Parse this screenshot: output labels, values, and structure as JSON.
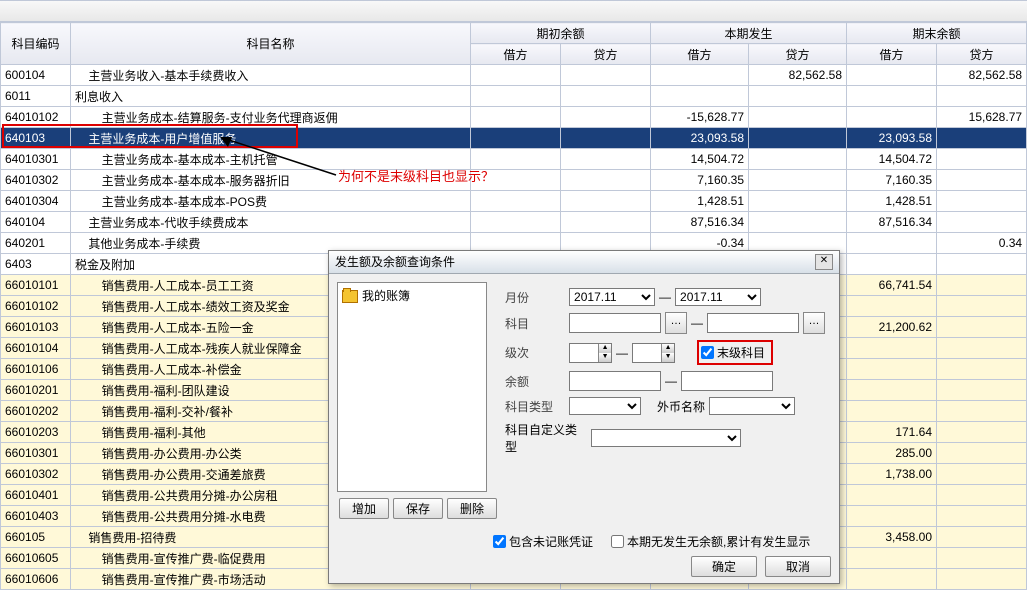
{
  "headers": {
    "code": "科目编码",
    "name": "科目名称",
    "opening": "期初余额",
    "current": "本期发生",
    "ending": "期末余额",
    "debit": "借方",
    "credit": "贷方"
  },
  "rows": [
    {
      "code": "600104",
      "name": "主营业务收入-基本手续费收入",
      "ind": 1,
      "oD": "",
      "oC": "",
      "cD": "",
      "cC": "82,562.58",
      "eD": "",
      "eC": "82,562.58"
    },
    {
      "code": "6011",
      "name": "利息收入",
      "ind": 0,
      "oD": "",
      "oC": "",
      "cD": "",
      "cC": "",
      "eD": "",
      "eC": ""
    },
    {
      "code": "64010102",
      "name": "主营业务成本-结算服务-支付业务代理商返佣",
      "ind": 2,
      "oD": "",
      "oC": "",
      "cD": "-15,628.77",
      "cC": "",
      "eD": "",
      "eC": "15,628.77"
    },
    {
      "code": "640103",
      "name": "主营业务成本-用户增值服务",
      "ind": 1,
      "oD": "",
      "oC": "",
      "cD": "23,093.58",
      "cC": "",
      "eD": "23,093.58",
      "eC": "",
      "sel": true
    },
    {
      "code": "64010301",
      "name": "主营业务成本-基本成本-主机托管",
      "ind": 2,
      "oD": "",
      "oC": "",
      "cD": "14,504.72",
      "cC": "",
      "eD": "14,504.72",
      "eC": ""
    },
    {
      "code": "64010302",
      "name": "主营业务成本-基本成本-服务器折旧",
      "ind": 2,
      "oD": "",
      "oC": "",
      "cD": "7,160.35",
      "cC": "",
      "eD": "7,160.35",
      "eC": ""
    },
    {
      "code": "64010304",
      "name": "主营业务成本-基本成本-POS费",
      "ind": 2,
      "oD": "",
      "oC": "",
      "cD": "1,428.51",
      "cC": "",
      "eD": "1,428.51",
      "eC": ""
    },
    {
      "code": "640104",
      "name": "主营业务成本-代收手续费成本",
      "ind": 1,
      "oD": "",
      "oC": "",
      "cD": "87,516.34",
      "cC": "",
      "eD": "87,516.34",
      "eC": ""
    },
    {
      "code": "640201",
      "name": "其他业务成本-手续费",
      "ind": 1,
      "oD": "",
      "oC": "",
      "cD": "-0.34",
      "cC": "",
      "eD": "",
      "eC": "0.34"
    },
    {
      "code": "6403",
      "name": "税金及附加",
      "ind": 0,
      "oD": "",
      "oC": "",
      "cD": "",
      "cC": "",
      "eD": "",
      "eC": ""
    },
    {
      "code": "66010101",
      "name": "销售费用-人工成本-员工工资",
      "ind": 2,
      "hl": true,
      "oD": "",
      "oC": "",
      "cD": "",
      "cC": "",
      "eD": "66,741.54",
      "eC": ""
    },
    {
      "code": "66010102",
      "name": "销售费用-人工成本-绩效工资及奖金",
      "ind": 2,
      "hl": true,
      "oD": "",
      "oC": "",
      "cD": "",
      "cC": "",
      "eD": "",
      "eC": ""
    },
    {
      "code": "66010103",
      "name": "销售费用-人工成本-五险一金",
      "ind": 2,
      "hl": true,
      "oD": "",
      "oC": "",
      "cD": "",
      "cC": "",
      "eD": "21,200.62",
      "eC": ""
    },
    {
      "code": "66010104",
      "name": "销售费用-人工成本-残疾人就业保障金",
      "ind": 2,
      "hl": true,
      "oD": "",
      "oC": "",
      "cD": "",
      "cC": "",
      "eD": "",
      "eC": ""
    },
    {
      "code": "66010106",
      "name": "销售费用-人工成本-补偿金",
      "ind": 2,
      "hl": true,
      "oD": "",
      "oC": "",
      "cD": "",
      "cC": "",
      "eD": "",
      "eC": ""
    },
    {
      "code": "66010201",
      "name": "销售费用-福利-团队建设",
      "ind": 2,
      "hl": true,
      "oD": "",
      "oC": "",
      "cD": "",
      "cC": "",
      "eD": "",
      "eC": ""
    },
    {
      "code": "66010202",
      "name": "销售费用-福利-交补/餐补",
      "ind": 2,
      "hl": true,
      "oD": "",
      "oC": "",
      "cD": "",
      "cC": "",
      "eD": "",
      "eC": ""
    },
    {
      "code": "66010203",
      "name": "销售费用-福利-其他",
      "ind": 2,
      "hl": true,
      "oD": "",
      "oC": "",
      "cD": "",
      "cC": "",
      "eD": "171.64",
      "eC": ""
    },
    {
      "code": "66010301",
      "name": "销售费用-办公费用-办公类",
      "ind": 2,
      "hl": true,
      "oD": "",
      "oC": "",
      "cD": "",
      "cC": "",
      "eD": "285.00",
      "eC": ""
    },
    {
      "code": "66010302",
      "name": "销售费用-办公费用-交通差旅费",
      "ind": 2,
      "hl": true,
      "oD": "",
      "oC": "",
      "cD": "",
      "cC": "",
      "eD": "1,738.00",
      "eC": ""
    },
    {
      "code": "66010401",
      "name": "销售费用-公共费用分摊-办公房租",
      "ind": 2,
      "hl": true,
      "oD": "",
      "oC": "",
      "cD": "",
      "cC": "",
      "eD": "",
      "eC": ""
    },
    {
      "code": "66010403",
      "name": "销售费用-公共费用分摊-水电费",
      "ind": 2,
      "hl": true,
      "oD": "",
      "oC": "",
      "cD": "",
      "cC": "",
      "eD": "",
      "eC": ""
    },
    {
      "code": "660105",
      "name": "销售费用-招待费",
      "ind": 1,
      "hl": true,
      "oD": "",
      "oC": "",
      "cD": "",
      "cC": "",
      "eD": "3,458.00",
      "eC": ""
    },
    {
      "code": "66010605",
      "name": "销售费用-宣传推广费-临促费用",
      "ind": 2,
      "hl": true,
      "oD": "",
      "oC": "",
      "cD": "",
      "cC": "",
      "eD": "",
      "eC": ""
    },
    {
      "code": "66010606",
      "name": "销售费用-宣传推广费-市场活动",
      "ind": 2,
      "hl": true,
      "oD": "",
      "oC": "",
      "cD": "",
      "cC": "",
      "eD": "",
      "eC": ""
    }
  ],
  "annotation_text": "为何不是末级科目也显示？",
  "dialog": {
    "title": "发生额及余额查询条件",
    "tree_root": "我的账簿",
    "btn_add": "增加",
    "btn_save": "保存",
    "btn_del": "删除",
    "lbl_month": "月份",
    "month_from": "2017.11",
    "month_to": "2017.11",
    "dash": "—",
    "lbl_account": "科目",
    "lbl_level": "级次",
    "chk_leaf": "末级科目",
    "lbl_balance": "余额",
    "lbl_acct_type": "科目类型",
    "lbl_currency": "外币名称",
    "lbl_custom_type": "科目自定义类型",
    "chk_unposted": "包含未记账凭证",
    "chk_suppress_zero": "本期无发生无余额,累计有发生显示",
    "btn_ok": "确定",
    "btn_cancel": "取消"
  }
}
